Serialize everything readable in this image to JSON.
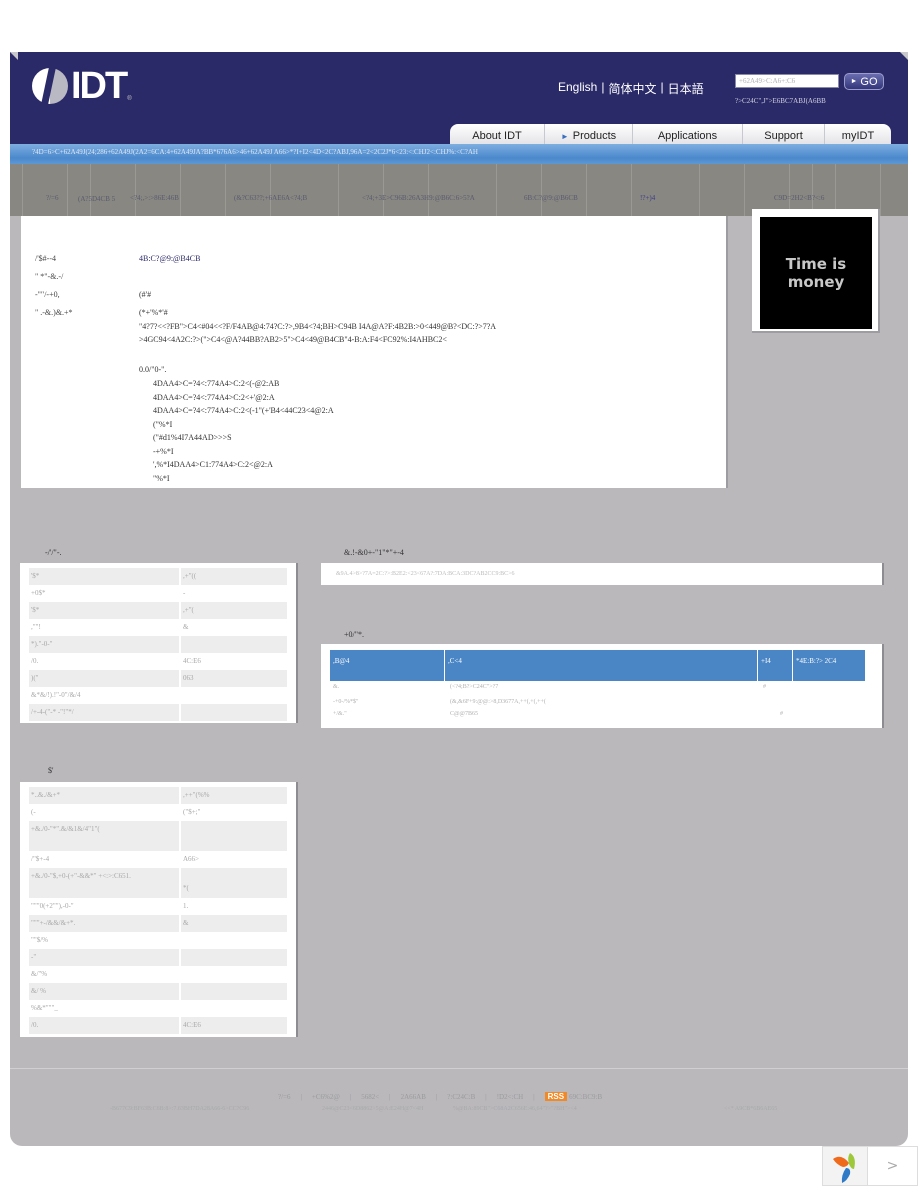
{
  "header": {
    "logo_text": "IDT",
    "logo_reg": "®",
    "languages": [
      "English",
      "|",
      "简体中文",
      "|",
      "日本語"
    ],
    "search_placeholder": "+62A49>C:A6+:C6",
    "search_button": "GO",
    "search_hint": "?>C24C\",J\">E6BC7ABJ(A6BB",
    "nav": [
      {
        "label": "About IDT",
        "marker": ""
      },
      {
        "label": "Products",
        "marker": "►"
      },
      {
        "label": "Applications",
        "marker": ""
      },
      {
        "label": "Support",
        "marker": ""
      },
      {
        "label": "myIDT",
        "marker": ""
      }
    ],
    "breadcrumb": "?4D=6>C+62A49J(24;286+62A49J(2A2=6CA:4+62A49JA?BB*676A6>46+62A49J A66>*?I+I2<4D<2C?ABJ,96A=2<2C2J*6<23:<:CHJ2<:CHJ%:<C?AH"
  },
  "subnav": [
    {
      "label": "?/=6"
    },
    {
      "label": "(A?5D4CB 5"
    },
    {
      "label": "<?4;,>:>86E:46B"
    },
    {
      "label": "(&?C63??;+6AE6A<?4;B"
    },
    {
      "label": "<?4;+3E>C96B:26A3H9:@B6C:6>5?A"
    },
    {
      "label": "6B:C?@9:@B6CB"
    },
    {
      "label": "!?+)4"
    },
    {
      "label": "C9D=2H2<B?<:6"
    }
  ],
  "detail": {
    "rows": [
      {
        "label": "/'$#--4",
        "value": "4B:C?@9:@B4CB",
        "link": true
      },
      {
        "label": "\" *\"-&.-/",
        "value": ""
      },
      {
        "label": "-\"\"/-+0,",
        "value": "(#'#"
      },
      {
        "label": "\" .-&.)&.+*",
        "value": "(*+'%*'#"
      }
    ],
    "desc_lines": [
      "\"4?7?<<?FB\">C4<#04<<?F/F4AB@4:74?C:?>,9B4<?4;BH>C94B I4A@A?F:4B2B:>0<449@B?<DC:?>7?A",
      ">4GC94<4A2C:?>(\">C4<@A?44BB?AB2>5\">C4<49@B4CB\"4-B:A:F4<FC92%:I4AHBC2<"
    ],
    "features_title": "0.0/\"0-\".",
    "features": [
      "4DAA4>C=?4<:774A4>C:2<(-@2:AB",
      "4DAA4>C=?4<:774A4>C:2<+'@2:A",
      "4DAA4>C=?4<:774A4>C:2<(-1\"(+'B4<44C23<4@2:A",
      "(\"%*I",
      "(\"#d1%4I7A44AD>>>S",
      "-+%*I",
      "',%*I4DAA4>C1:774A4>C:2<@2:A",
      "\"%*I"
    ]
  },
  "ad": {
    "line1": "Time is",
    "line2": "money"
  },
  "details_section": {
    "title": "-/'/\"-.",
    "rows": [
      {
        "k": "'$*",
        "v": ",+\"(("
      },
      {
        "k": "+0$*",
        "v": "-"
      },
      {
        "k": "'$*",
        "v": ",+\"("
      },
      {
        "k": ",\"\"!",
        "v": "&"
      },
      {
        "k": "*).\"-0-\"",
        "v": ""
      },
      {
        "k": "/0.",
        "v": "4C:E6"
      },
      {
        "k": ")(\"",
        "v": "063"
      },
      {
        "k": "&*&/!).!\"-0\"/&/4",
        "v": null
      },
      {
        "k": "/+-4-(\"-* -\"!\"*/",
        "v": ""
      }
    ]
  },
  "documents_section": {
    "title": "&.!-&0+-\"1\"*\"+-4",
    "text": "&9A.4>8>?7A=2C:?>:B2E2:<23<67A?:7DA:BCA:3DC?AB2CC9:BC>6"
  },
  "similar_section": {
    "title": "+0/\"*.",
    "headers": [
      ",B@4",
      ",C<4",
      "+I4",
      "*4E:B:?> 2C4"
    ],
    "rows": [
      {
        "c1": "&.",
        "c2": "(<?4;B?>C24C\">?7",
        "c3": "#",
        "c4": ""
      },
      {
        "c1": "-+0-/%*$\"",
        "c2": "(&,&6F+9:@@:>8,D3677A,++(,+(,++(",
        "c3": "",
        "c4": ""
      },
      {
        "c1": "+/&.\"",
        "c2": "C@@7B65",
        "c3": "",
        "c4": "#"
      }
    ]
  },
  "pricing_section": {
    "title": "$'",
    "rows": [
      {
        "k": "*..&./&+*",
        "v": ",++\"(%%"
      },
      {
        "k": "(-",
        "v": "(\"$+;\""
      },
      {
        "k": "+&./0-\"*\".&/&1&/4\"1\"(",
        "v": "",
        "tall": true
      },
      {
        "k": "/\"$+-4",
        "v": "A66>"
      },
      {
        "k": "+&./0-\"$,+0-(+\"-&&*\" +<:>:C651.",
        "v": "*(",
        "tall": true
      },
      {
        "k": "\"\"\"0(+2\"\"),-0-\"",
        "v": "1."
      },
      {
        "k": "\"\"\"+-/&&/&+*.",
        "v": "&"
      },
      {
        "k": "\"\"$/%",
        "v": ""
      },
      {
        "k": "-\"",
        "v": ""
      },
      {
        "k": "&/\"%",
        "v": ""
      },
      {
        "k": "&/ %",
        "v": ""
      },
      {
        "k": "%&*\"\"\"_",
        "v": ""
      },
      {
        "k": "/0.",
        "v": "4C:E6"
      }
    ]
  },
  "footer": {
    "links": [
      "?/=6",
      "|",
      "+C6%2@",
      "|",
      "5682<",
      "|",
      "2A66AB",
      "|",
      "?:C24C:B",
      "|",
      "!D2<:CH",
      "|"
    ],
    "rss_label": "RSS",
    "rss_text": "69C:BC9:B",
    "bottom_left": "-B677C9:BF63B:C6B:8>:7.63BH7DA28A66-6>CC?C96",
    "bottom_mid": "2446@C23<6D8862>5@A:E24H@7<4H",
    "bottom_mid2": "%@BA:89CB\">C68A2C656E:46,64\"?>\"?BH\"><4",
    "bottom_right": "<<* A9CB*6B6AE65"
  },
  "badge": {
    "next_label": ">"
  }
}
